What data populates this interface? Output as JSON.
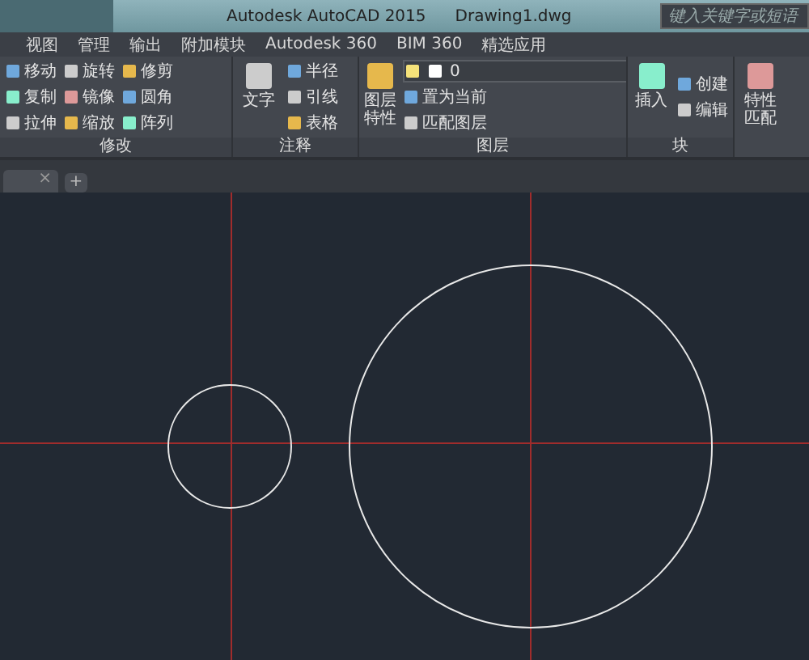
{
  "window": {
    "app_title": "Autodesk AutoCAD 2015",
    "file_title": "Drawing1.dwg",
    "search": {
      "placeholder": "键入关键字或短语"
    }
  },
  "menu_tabs": [
    {
      "label": "视图",
      "selected": false
    },
    {
      "label": "管理",
      "selected": false
    },
    {
      "label": "输出",
      "selected": false
    },
    {
      "label": "附加模块",
      "selected": false
    },
    {
      "label": "Autodesk 360",
      "selected": false
    },
    {
      "label": "BIM 360",
      "selected": false
    },
    {
      "label": "精选应用",
      "selected": false
    }
  ],
  "ribbon": {
    "panels": [
      {
        "title": "修改",
        "kind": "grid",
        "tools": [
          {
            "label": "移动"
          },
          {
            "label": "旋转"
          },
          {
            "label": "修剪"
          },
          {
            "label": "复制"
          },
          {
            "label": "镜像"
          },
          {
            "label": "圆角"
          },
          {
            "label": "拉伸"
          },
          {
            "label": "缩放"
          },
          {
            "label": "阵列"
          }
        ]
      },
      {
        "title": "注释",
        "kind": "big",
        "big": "文字",
        "tools": [
          {
            "label": "半径"
          },
          {
            "label": "引线"
          },
          {
            "label": "表格"
          }
        ]
      },
      {
        "title": "图层",
        "kind": "layer",
        "big": "图层特性",
        "layer": "0",
        "tools": [
          {
            "label": "置为当前"
          },
          {
            "label": "匹配图层"
          }
        ]
      },
      {
        "title": "块",
        "kind": "big",
        "big": "插入",
        "tools": [
          {
            "label": "创建"
          },
          {
            "label": "编辑"
          }
        ]
      },
      {
        "kind": "bigonly",
        "big": "特性匹配"
      }
    ]
  },
  "doc_tabs": {
    "close": "×",
    "add": "+"
  }
}
